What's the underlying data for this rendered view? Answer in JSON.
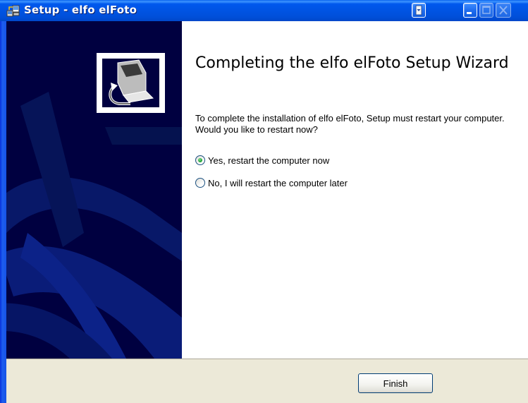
{
  "window": {
    "title": "Setup - elfo elFoto",
    "icon": "setup-installer-icon"
  },
  "titlebar_buttons": {
    "menu": "menu-icon",
    "minimize": "minimize-icon",
    "maximize": "maximize-icon",
    "close": "close-icon"
  },
  "wizard": {
    "heading": "Completing the elfo elFoto Setup Wizard",
    "message": "To complete the installation of elfo elFoto, Setup must restart your computer. Would you like to restart now?",
    "options": [
      {
        "label": "Yes, restart the computer now",
        "checked": true
      },
      {
        "label": "No, I will restart the computer later",
        "checked": false
      }
    ]
  },
  "footer": {
    "finish_label": "Finish"
  },
  "colors": {
    "titlebar": "#0054e3",
    "side_panel": "#000040",
    "footer_bg": "#ece9d8"
  }
}
